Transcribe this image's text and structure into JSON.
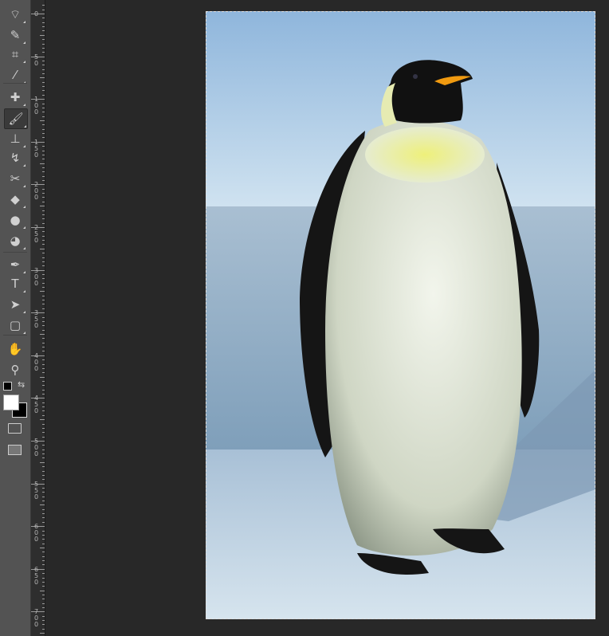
{
  "tools": [
    {
      "name": "lasso-tool",
      "glyph": "⌔"
    },
    {
      "name": "quick-selection-tool",
      "glyph": "✎"
    },
    {
      "name": "crop-tool",
      "glyph": "⌗"
    },
    {
      "name": "eyedropper-tool",
      "glyph": "⁄"
    },
    {
      "name": "healing-brush-tool",
      "glyph": "✚"
    },
    {
      "name": "brush-tool",
      "glyph": "🖌",
      "active": true
    },
    {
      "name": "clone-stamp-tool",
      "glyph": "⊥"
    },
    {
      "name": "history-brush-tool",
      "glyph": "↯"
    },
    {
      "name": "eraser-tool",
      "glyph": "✂"
    },
    {
      "name": "paint-bucket-tool",
      "glyph": "◆"
    },
    {
      "name": "blur-tool",
      "glyph": "●"
    },
    {
      "name": "dodge-tool",
      "glyph": "◕"
    },
    {
      "name": "pen-tool",
      "glyph": "✒"
    },
    {
      "name": "type-tool",
      "glyph": "T"
    },
    {
      "name": "path-selection-tool",
      "glyph": "➤"
    },
    {
      "name": "rectangle-tool",
      "glyph": "▢"
    },
    {
      "name": "hand-tool",
      "glyph": "✋"
    },
    {
      "name": "zoom-tool",
      "glyph": "⚲"
    }
  ],
  "ruler_labels": [
    "0",
    "50",
    "100",
    "150",
    "200",
    "250",
    "300",
    "350",
    "400",
    "450",
    "500",
    "550",
    "600",
    "650",
    "700"
  ],
  "colors": {
    "foreground": "#ffffff",
    "background": "#000000"
  }
}
